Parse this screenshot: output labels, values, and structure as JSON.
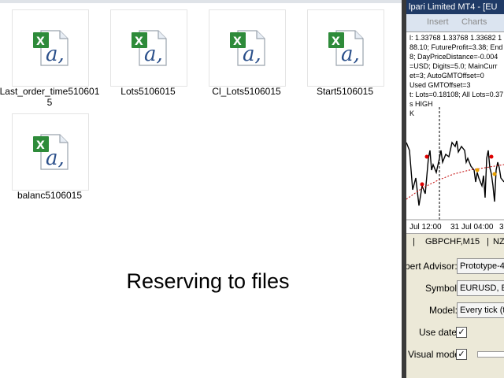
{
  "files": [
    {
      "name": "Last_order_time5106015",
      "icon": "excel-csv-icon"
    },
    {
      "name": "Lots5106015",
      "icon": "excel-csv-icon"
    },
    {
      "name": "Cl_Lots5106015",
      "icon": "excel-csv-icon"
    },
    {
      "name": "Start5106015",
      "icon": "excel-csv-icon"
    },
    {
      "name": "balanc5106015",
      "icon": "excel-csv-icon"
    }
  ],
  "caption": "Reserving to files",
  "mt4": {
    "title": "lpari Limited MT4 - [EU",
    "menu": {
      "insert": "Insert",
      "charts": "Charts"
    },
    "info_lines": [
      "l: 1.33768 1.33768 1.33682 1",
      "88.10; FutureProfit=3.38; End",
      "8; DayPriceDistance=-0.004",
      "=USD; Digits=5.0; MainCurr",
      "et=3; AutoGMTOffset=0",
      " Used GMTOffset=3",
      "t: Lots=0.18108; All Lots=0.37",
      "s HIGH",
      "K"
    ],
    "time_labels": [
      "Jul 12:00",
      "31 Jul 04:00",
      "3"
    ],
    "tabs": [
      "GBPCHF,M15",
      "NZ"
    ],
    "tester": {
      "expert_label": "pert Advisor:",
      "expert_value": "Prototype-4,",
      "symbol_label": "Symbol:",
      "symbol_value": "EURUSD, E",
      "model_label": "Model:",
      "model_value": "Every tick (t",
      "use_date_label": "Use date",
      "visual_mode_label": "Visual mode",
      "check_mark": "✓"
    }
  }
}
